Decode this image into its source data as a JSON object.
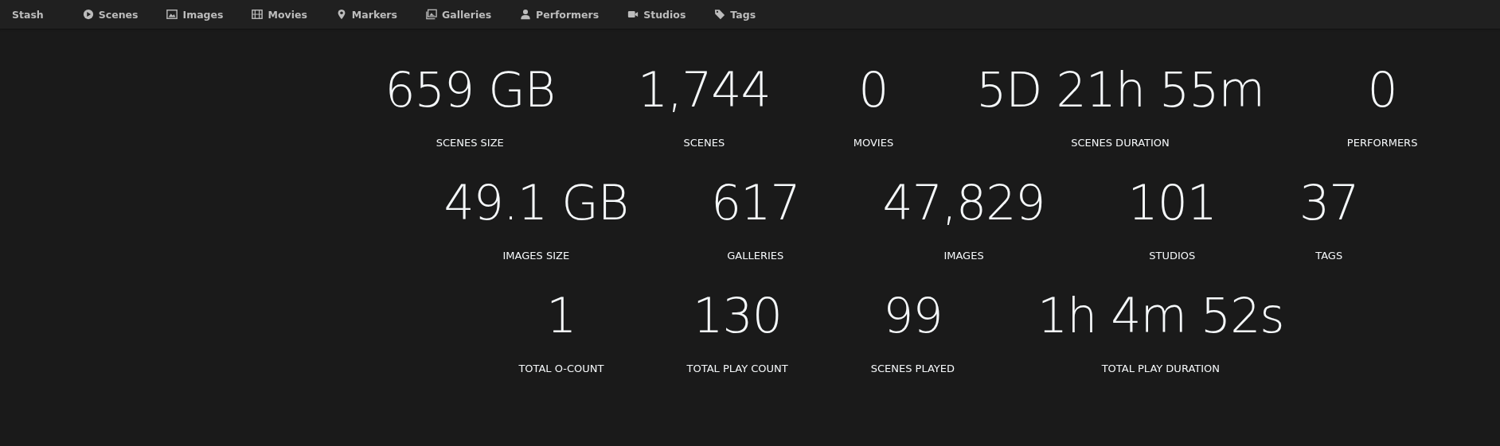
{
  "navbar": {
    "brand": "Stash",
    "items": [
      {
        "label": "Scenes"
      },
      {
        "label": "Images"
      },
      {
        "label": "Movies"
      },
      {
        "label": "Markers"
      },
      {
        "label": "Galleries"
      },
      {
        "label": "Performers"
      },
      {
        "label": "Studios"
      },
      {
        "label": "Tags"
      }
    ]
  },
  "stats_rows": [
    [
      {
        "value": "659 GB",
        "label": "SCENES SIZE"
      },
      {
        "value": "1,744",
        "label": "SCENES"
      },
      {
        "value": "0",
        "label": "MOVIES"
      },
      {
        "value": "5D 21h 55m",
        "label": "SCENES DURATION"
      },
      {
        "value": "0",
        "label": "PERFORMERS"
      }
    ],
    [
      {
        "value": "49.1 GB",
        "label": "IMAGES SIZE"
      },
      {
        "value": "617",
        "label": "GALLERIES"
      },
      {
        "value": "47,829",
        "label": "IMAGES"
      },
      {
        "value": "101",
        "label": "STUDIOS"
      },
      {
        "value": "37",
        "label": "TAGS"
      }
    ],
    [
      {
        "value": "1",
        "label": "TOTAL O-COUNT"
      },
      {
        "value": "130",
        "label": "TOTAL PLAY COUNT"
      },
      {
        "value": "99",
        "label": "SCENES PLAYED"
      },
      {
        "value": "1h 4m 52s",
        "label": "TOTAL PLAY DURATION"
      }
    ]
  ]
}
